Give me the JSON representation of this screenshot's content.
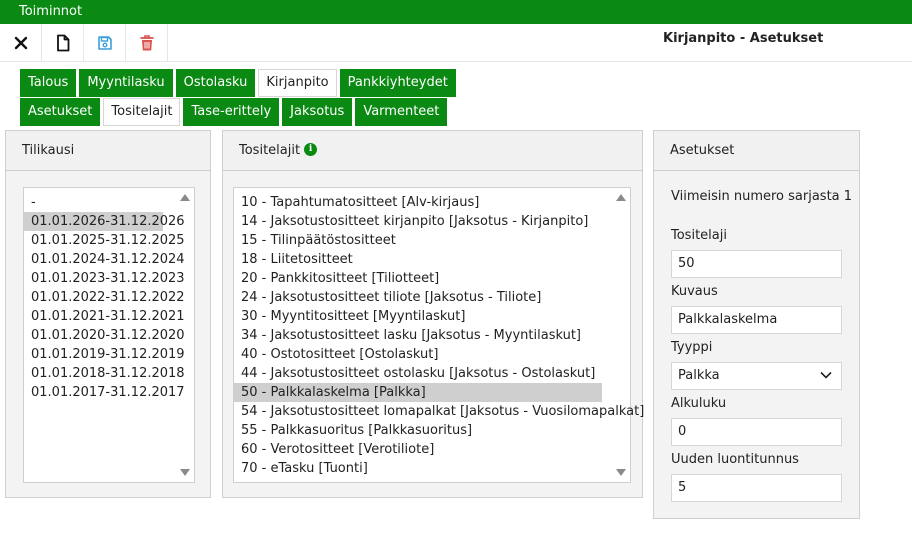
{
  "app": {
    "title": "Toiminnot",
    "page_title": "Kirjanpito - Asetukset"
  },
  "toolbar": {
    "icons": [
      "close-icon",
      "new-document-icon",
      "save-icon",
      "delete-icon"
    ]
  },
  "tabs_main": [
    "Talous",
    "Myyntilasku",
    "Ostolasku",
    "Kirjanpito",
    "Pankkiyhteydet"
  ],
  "tabs_sub": [
    "Asetukset",
    "Tositelajit",
    "Tase-erittely",
    "Jaksotus",
    "Varmenteet"
  ],
  "active": {
    "main_tab": "Kirjanpito",
    "sub_tab": "Tositelajit"
  },
  "tilikausi": {
    "header": "Tilikausi",
    "items": [
      "-",
      "01.01.2026-31.12.2026",
      "01.01.2025-31.12.2025",
      "01.01.2024-31.12.2024",
      "01.01.2023-31.12.2023",
      "01.01.2022-31.12.2022",
      "01.01.2021-31.12.2021",
      "01.01.2020-31.12.2020",
      "01.01.2019-31.12.2019",
      "01.01.2018-31.12.2018",
      "01.01.2017-31.12.2017"
    ],
    "selected": "01.01.2026-31.12.2026"
  },
  "tositelajit": {
    "header": "Tositelajit",
    "items": [
      "10 - Tapahtumatositteet [Alv-kirjaus]",
      "14 - Jaksotustositteet kirjanpito [Jaksotus - Kirjanpito]",
      "15 - Tilinpäätöstositteet",
      "18 - Liitetositteet",
      "20 - Pankkitositteet [Tiliotteet]",
      "24 - Jaksotustositteet tiliote [Jaksotus - Tiliote]",
      "30 - Myyntitositteet [Myyntilaskut]",
      "34 - Jaksotustositteet lasku [Jaksotus - Myyntilaskut]",
      "40 - Ostotositteet [Ostolaskut]",
      "44 - Jaksotustositteet ostolasku [Jaksotus - Ostolaskut]",
      "50 - Palkkalaskelma [Palkka]",
      "54 - Jaksotustositteet lomapalkat [Jaksotus - Vuosilomapalkat]",
      "55 - Palkkasuoritus [Palkkasuoritus]",
      "60 - Verotositteet [Verotiliote]",
      "70 - eTasku [Tuonti]"
    ],
    "selected": "50 - Palkkalaskelma [Palkka]"
  },
  "asetukset": {
    "header": "Asetukset",
    "info": "Viimeisin numero sarjasta 1",
    "tositelaji_label": "Tositelaji",
    "tositelaji_value": "50",
    "kuvaus_label": "Kuvaus",
    "kuvaus_value": "Palkkalaskelma",
    "tyyppi_label": "Tyyppi",
    "tyyppi_value": "Palkka",
    "alkuluku_label": "Alkuluku",
    "alkuluku_value": "0",
    "tunnus_label": "Uuden luontitunnus",
    "tunnus_value": "5"
  },
  "colors": {
    "brand_green": "#0a8a12",
    "save_blue": "#3aa0d8",
    "delete_red": "#d9534f"
  }
}
